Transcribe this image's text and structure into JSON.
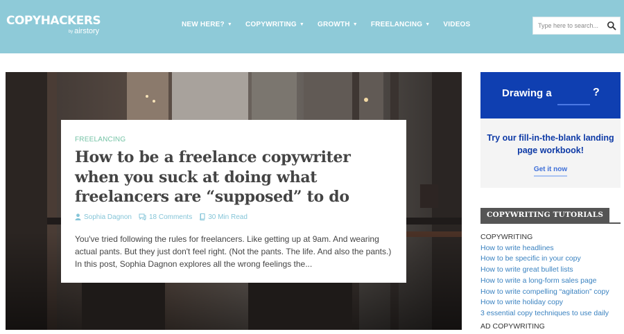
{
  "header": {
    "logo_main": "COPYHACKERS",
    "logo_by": "by",
    "logo_sub": "airstory",
    "nav": [
      {
        "label": "NEW HERE?",
        "dropdown": true
      },
      {
        "label": "COPYWRITING",
        "dropdown": true
      },
      {
        "label": "GROWTH",
        "dropdown": true
      },
      {
        "label": "FREELANCING",
        "dropdown": true
      },
      {
        "label": "VIDEOS",
        "dropdown": false
      }
    ],
    "search_placeholder": "Type here to search...",
    "search_icon": "search-icon",
    "background_color": "#8ecad8"
  },
  "featured": {
    "category": "FREELANCING",
    "title": "How to be a freelance copywriter when you suck at doing what freelancers are “supposed” to do",
    "author": "Sophia Dagnon",
    "comments": "18 Comments",
    "read_time": "30 Min Read",
    "excerpt": "You've tried following the rules for freelancers. Like getting up at 9am. And wearing actual pants. But they just don't feel right. (Not the pants. The life. And also the pants.) In this post, Sophia Dagnon explores all the wrong feelings the...",
    "icons": {
      "author": "user-icon",
      "comments": "comments-icon",
      "read_time": "book-icon"
    },
    "accent_color": "#74c3a5"
  },
  "sidebar_ad": {
    "headline": "Drawing a",
    "headline_end": "?",
    "text": "Try our fill-in-the-blank landing page workbook!",
    "link": "Get it now",
    "brand_color": "#0f3fb1"
  },
  "tutorials": {
    "heading": "COPYWRITING TUTORIALS",
    "section_1": "COPYWRITING",
    "links": [
      "How to write headlines",
      "How to be specific in your copy",
      "How to write great bullet lists",
      "How to write a long-form sales page",
      "How to write compelling “agitation” copy",
      "How to write holiday copy",
      "3 essential copy techniques to use daily"
    ],
    "section_2": "AD COPYWRITING"
  }
}
